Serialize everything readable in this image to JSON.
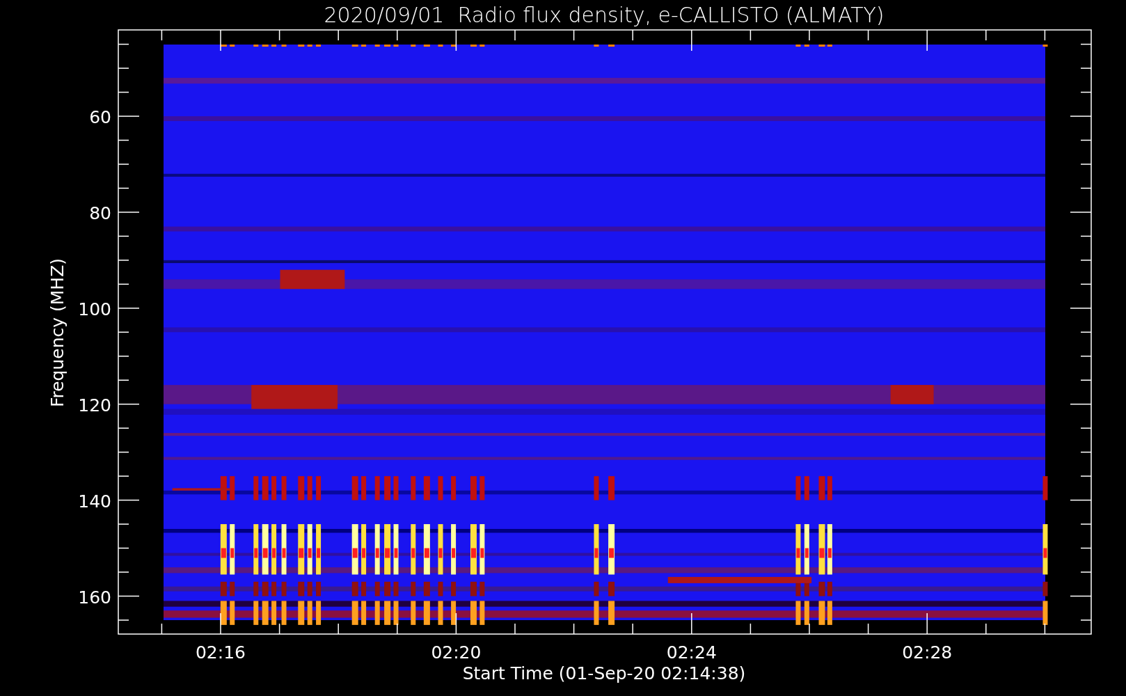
{
  "title": "2020/09/01  Radio flux density, e-CALLISTO (ALMATY)",
  "y_axis": {
    "label": "Frequency (MHZ)",
    "ticks": [
      "60",
      "80",
      "100",
      "120",
      "140",
      "160"
    ]
  },
  "x_axis": {
    "label": "Start Time (01-Sep-20 02:14:38)",
    "ticks": [
      "02:16",
      "02:20",
      "02:24",
      "02:28"
    ]
  }
}
